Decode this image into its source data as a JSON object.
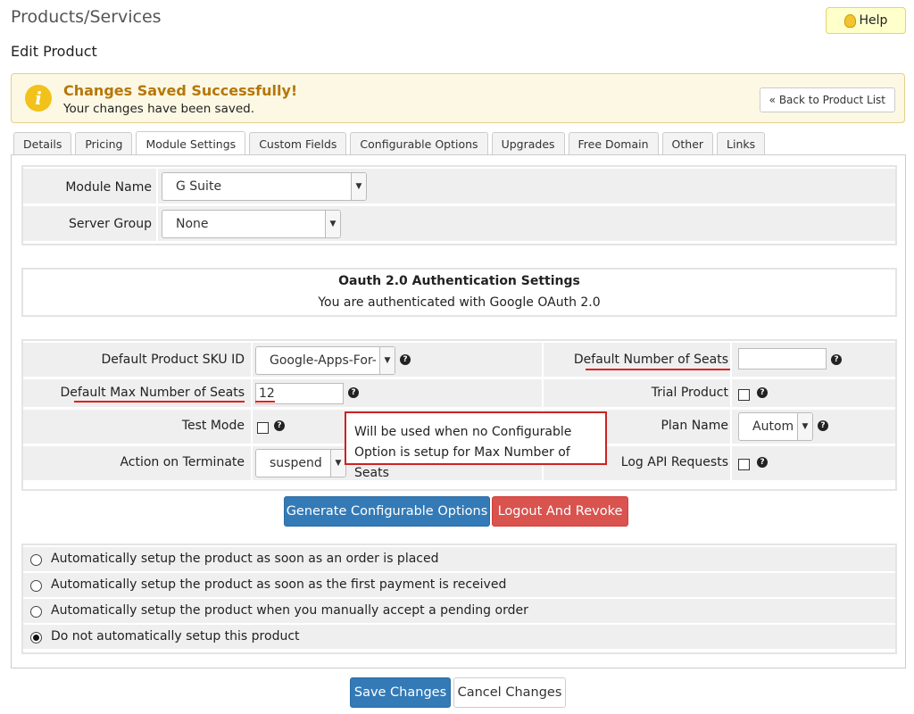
{
  "header": {
    "title": "Products/Services",
    "subtitle": "Edit Product",
    "help_label": "Help",
    "help_icon": "lightbulb-icon"
  },
  "alert": {
    "icon": "info-icon",
    "icon_glyph": "i",
    "title": "Changes Saved Successfully!",
    "text": "Your changes have been saved.",
    "back_label": "« Back to Product List"
  },
  "tabs": [
    {
      "label": "Details"
    },
    {
      "label": "Pricing"
    },
    {
      "label": "Module Settings",
      "active": true
    },
    {
      "label": "Custom Fields"
    },
    {
      "label": "Configurable Options"
    },
    {
      "label": "Upgrades"
    },
    {
      "label": "Free Domain"
    },
    {
      "label": "Other"
    },
    {
      "label": "Links"
    }
  ],
  "module": {
    "module_name_label": "Module Name",
    "module_name_value": "G Suite",
    "server_group_label": "Server Group",
    "server_group_value": "None"
  },
  "oauth": {
    "title": "Oauth 2.0 Authentication Settings",
    "text": "You are authenticated with Google OAuth 2.0"
  },
  "settings": {
    "sku_label": "Default Product SKU ID",
    "sku_value": "Google-Apps-For-",
    "seats_label": "Default Number of Seats",
    "seats_value": "",
    "max_seats_label": "Default Max Number of Seats",
    "max_seats_value": "12",
    "trial_label": "Trial Product",
    "test_mode_label": "Test Mode",
    "plan_label": "Plan Name",
    "plan_value": "Autom",
    "terminate_label": "Action on Terminate",
    "terminate_value": "suspend",
    "log_api_label": "Log API Requests",
    "help_glyph": "?",
    "dropdown_glyph": "▼",
    "tooltip": "Will be used when no Configurable Option is setup for Max Number of Seats"
  },
  "actions": {
    "generate_label": "Generate Configurable Options",
    "logout_label": "Logout And Revoke"
  },
  "setup_options": [
    {
      "label": "Automatically setup the product as soon as an order is placed",
      "selected": false
    },
    {
      "label": "Automatically setup the product as soon as the first payment is received",
      "selected": false
    },
    {
      "label": "Automatically setup the product when you manually accept a pending order",
      "selected": false
    },
    {
      "label": "Do not automatically setup this product",
      "selected": true
    }
  ],
  "footer": {
    "save_label": "Save Changes",
    "cancel_label": "Cancel Changes"
  },
  "colors": {
    "primary": "#337ab7",
    "danger": "#d9534f",
    "alert_bg": "#fcf8e3",
    "alert_title": "#b5770a",
    "annotation": "#cc2222"
  }
}
